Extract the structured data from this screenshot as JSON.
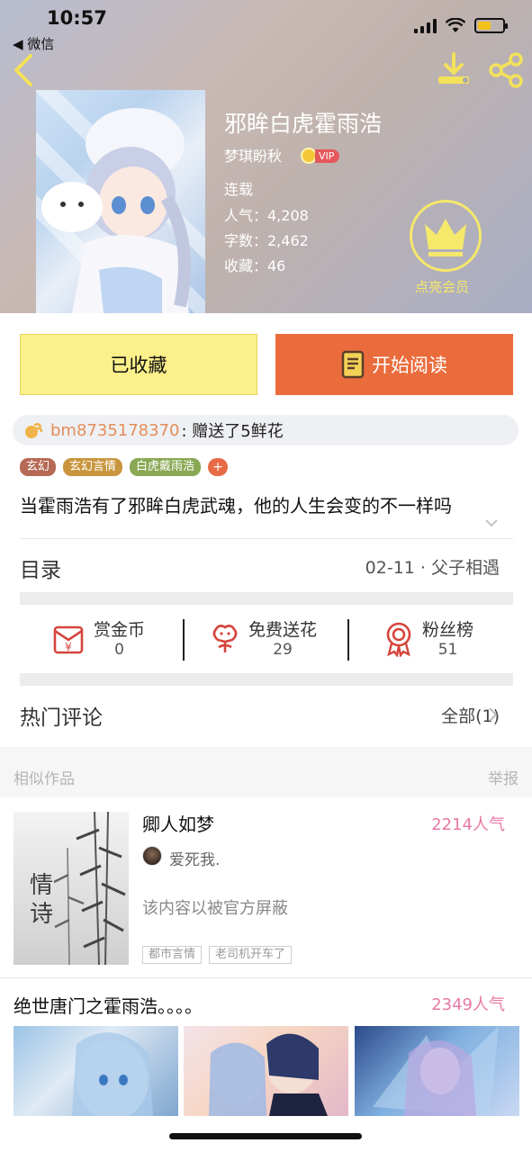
{
  "status_bar": {
    "time": "10:57",
    "back_app": "◀ 微信"
  },
  "book": {
    "title": "邪眸白虎霍雨浩",
    "author": "梦琪盼秋",
    "vip": "VIP",
    "status": "连载",
    "popularity_line": "人气：4,208",
    "words_line": "字数：2,462",
    "favorites_line": "收藏：46",
    "member_label": "点亮会员"
  },
  "actions": {
    "collected_label": "已收藏",
    "read_label": "开始阅读"
  },
  "gift": {
    "user": "bm8735178370",
    "text": ": 赠送了5鲜花"
  },
  "tags": [
    {
      "label": "玄幻",
      "color": "#b66a55"
    },
    {
      "label": "玄幻言情",
      "color": "#c9963f"
    },
    {
      "label": "白虎戴雨浩",
      "color": "#8aa854"
    }
  ],
  "tag_add": "+",
  "description": "当霍雨浩有了邪眸白虎武魂，他的人生会变的不一样吗",
  "toc": {
    "label": "目录",
    "latest": "02-11 · 父子相遇"
  },
  "stats": [
    {
      "name": "赏金币",
      "count": "0",
      "icon": "reward-coin-icon"
    },
    {
      "name": "免费送花",
      "count": "29",
      "icon": "flower-icon"
    },
    {
      "name": "粉丝榜",
      "count": "51",
      "icon": "medal-icon"
    }
  ],
  "comments": {
    "label": "热门评论",
    "all": "全部(1)"
  },
  "similar": {
    "label": "相似作品",
    "report": "举报"
  },
  "similar_items": [
    {
      "title": "卿人如梦",
      "popularity": "2214人气",
      "author": "爱死我.",
      "desc": "该内容以被官方屏蔽",
      "tags": [
        "都市言情",
        "老司机开车了"
      ],
      "cover_text": "情诗"
    },
    {
      "title": "绝世唐门之霍雨浩。。。。",
      "popularity": "2349人气"
    }
  ],
  "colors": {
    "accent_orange": "#ea6c3c",
    "collected_yellow": "#fbf08a",
    "popularity_pink": "#e879a5"
  }
}
